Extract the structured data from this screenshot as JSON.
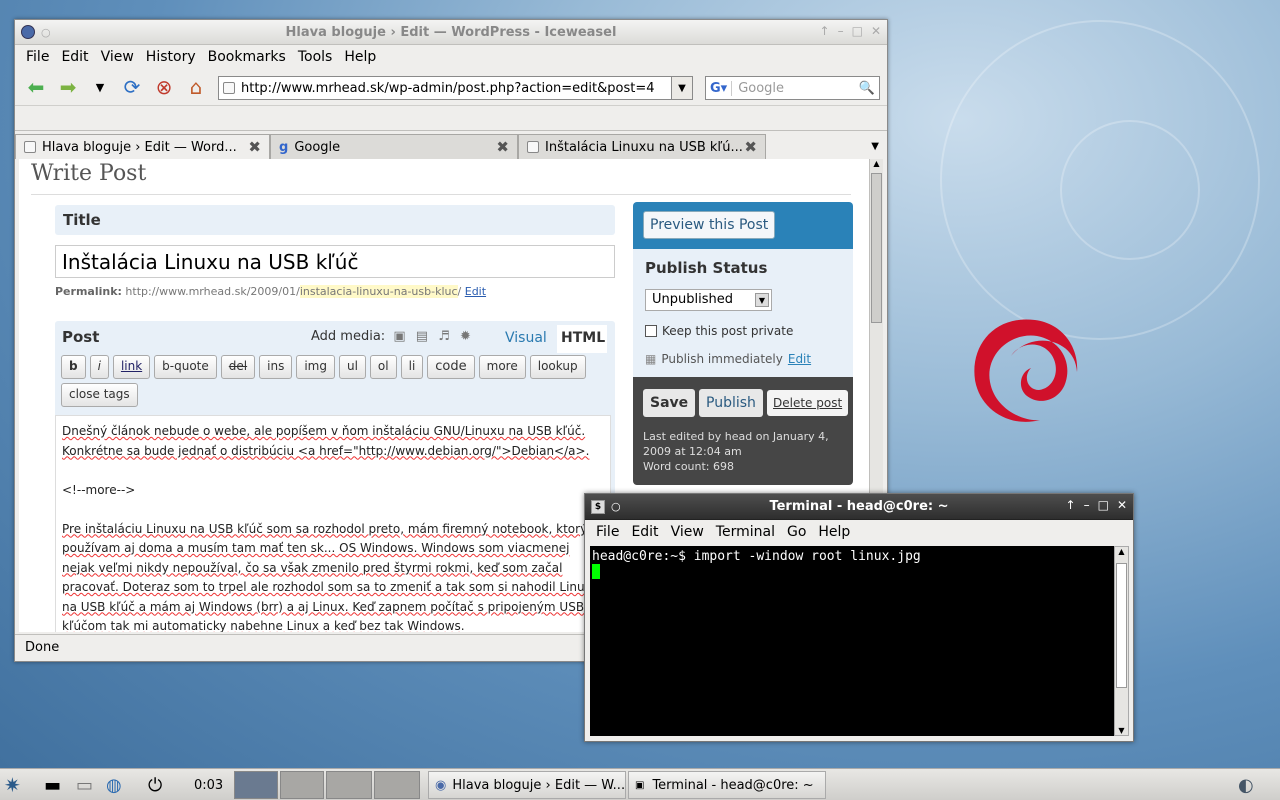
{
  "browser": {
    "title": "Hlava bloguje › Edit — WordPress - Iceweasel",
    "menu": [
      "File",
      "Edit",
      "View",
      "History",
      "Bookmarks",
      "Tools",
      "Help"
    ],
    "url": "http://www.mrhead.sk/wp-admin/post.php?action=edit&post=4",
    "search_placeholder": "Google",
    "tabs": [
      {
        "label": "Hlava bloguje › Edit — Word..."
      },
      {
        "label": "Google"
      },
      {
        "label": "Inštalácia Linuxu na USB kľú..."
      }
    ],
    "status": "Done"
  },
  "page": {
    "heading": "Write Post",
    "title_label": "Title",
    "post_title": "Inštalácia Linuxu na USB kľúč",
    "permalink_label": "Permalink:",
    "permalink_base": "http://www.mrhead.sk/2009/01/",
    "permalink_slug": "instalacia-linuxu-na-usb-kluc",
    "permalink_end": "/",
    "permalink_edit": "Edit",
    "post_label": "Post",
    "add_media": "Add media:",
    "tab_visual": "Visual",
    "tab_html": "HTML",
    "quicktags": [
      "b",
      "i",
      "link",
      "b-quote",
      "del",
      "ins",
      "img",
      "ul",
      "ol",
      "li",
      "code",
      "more",
      "lookup",
      "close tags"
    ],
    "editor_lines": [
      "Dnešný článok nebude o webe, ale popíšem v ňom inštaláciu GNU/Linuxu na USB kľúč.",
      "Konkrétne sa bude jednať o distribúciu <a href=\"http://www.debian.org/\">Debian</a>.",
      "",
      "<!--more-->",
      "",
      "Pre inštaláciu Linuxu na USB kľúč som sa rozhodol preto, mám firemný notebook, ktorý",
      "používam aj doma a musím tam mať ten sk... OS Windows. Windows som viacmenej",
      "nejak veľmi nikdy nepoužíval, čo sa však zmenilo pred štyrmi rokmi, keď som začal",
      "pracovať. Doteraz som to trpel ale rozhodol som sa to zmeniť a tak som si nahodil Linux",
      "na USB kľúč a mám aj Windows (brr) a aj Linux. Keď zapnem počítač s pripojeným USB",
      "kľúčom tak mi automaticky nabehne Linux a keď bez tak Windows."
    ],
    "preview_button": "Preview this Post",
    "publish_status_label": "Publish Status",
    "status_value": "Unpublished",
    "keep_private": "Keep this post private",
    "publish_immediately": "Publish immediately",
    "publish_edit": "Edit",
    "save": "Save",
    "publish": "Publish",
    "delete_post": "Delete post",
    "last_edited": "Last edited by head on January 4, 2009 at 12:04 am",
    "word_count": "Word count: 698"
  },
  "terminal": {
    "title": "Terminal - head@c0re: ~",
    "menu": [
      "File",
      "Edit",
      "View",
      "Terminal",
      "Go",
      "Help"
    ],
    "prompt_line": "head@c0re:~$ import -window root linux.jpg"
  },
  "taskbar": {
    "clock": "0:03",
    "tasks": [
      {
        "label": "Hlava bloguje › Edit — W..."
      },
      {
        "label": "Terminal - head@c0re: ~"
      }
    ]
  },
  "colors": {
    "wp_blue": "#2a82b8",
    "wp_dark": "#464646",
    "cursor": "#00ff00"
  }
}
